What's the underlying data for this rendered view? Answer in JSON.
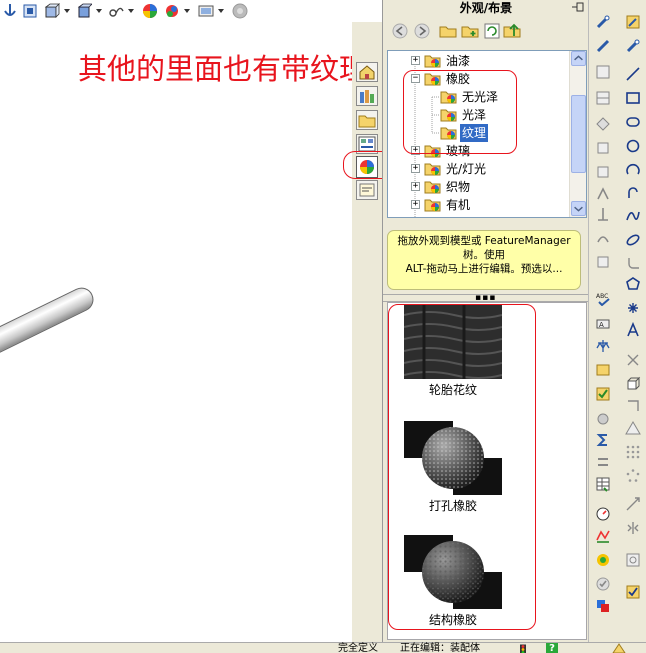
{
  "annotation": "其他的里面也有带纹理的",
  "task_pane": {
    "title": "外观/布景",
    "tree": [
      {
        "label": "油漆",
        "level": 0,
        "expander": "+",
        "selected": false
      },
      {
        "label": "橡胶",
        "level": 0,
        "expander": "−",
        "selected": false
      },
      {
        "label": "无光泽",
        "level": 1,
        "expander": "",
        "selected": false
      },
      {
        "label": "光泽",
        "level": 1,
        "expander": "",
        "selected": false
      },
      {
        "label": "纹理",
        "level": 1,
        "expander": "",
        "selected": true
      },
      {
        "label": "玻璃",
        "level": 0,
        "expander": "+",
        "selected": false
      },
      {
        "label": "光/灯光",
        "level": 0,
        "expander": "+",
        "selected": false
      },
      {
        "label": "织物",
        "level": 0,
        "expander": "+",
        "selected": false
      },
      {
        "label": "有机",
        "level": 0,
        "expander": "+",
        "selected": false
      }
    ],
    "tip_lines": [
      "拖放外观到模型或 FeatureManager",
      "树。使用",
      "ALT-拖动马上进行编辑。预选以..."
    ],
    "swatches": [
      {
        "label": "轮胎花纹",
        "pattern": "tire-tread"
      },
      {
        "label": "打孔橡胶",
        "pattern": "perforated-sphere"
      },
      {
        "label": "结构橡胶",
        "pattern": "textured-sphere"
      }
    ]
  },
  "status_bar": {
    "state": "完全定义",
    "editing": "正在编辑：装配体",
    "help": "?"
  },
  "colors": {
    "annotation_red": "#e8141d",
    "selection_blue": "#316ac5",
    "panel_bg": "#ece9d8",
    "tip_yellow": "#ffffa8"
  },
  "icons": {
    "top_toolbar": [
      "view-orientation-icon",
      "standard-views-icon",
      "display-style-icon",
      "section-view-icon",
      "hide-show-icon",
      "edit-appearance-icon",
      "apply-scene-icon",
      "view-settings-icon",
      "realview-icon"
    ],
    "tab_strip": [
      "home-resources-icon",
      "design-library-icon",
      "file-explorer-icon",
      "view-palette-icon",
      "appearances-icon",
      "custom-properties-icon"
    ],
    "right_toolbar": [
      "smart-dimension-icon",
      "sketch-icon",
      "line-icon",
      "rectangle-icon",
      "circle-icon",
      "arc-icon",
      "spline-icon",
      "ellipse-icon",
      "point-icon",
      "centerline-icon"
    ]
  }
}
